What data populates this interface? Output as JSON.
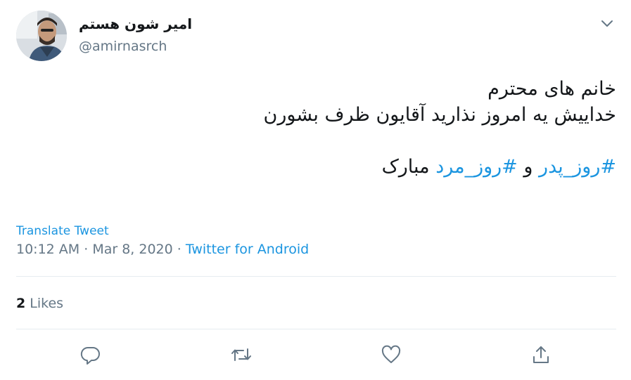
{
  "user": {
    "name": "امیر شون هستم",
    "handle": "@amirnasrch"
  },
  "tweet": {
    "line1": "خانم های محترم",
    "line2": "خداییش یه امروز نذارید آقایون ظرف بشورن",
    "hashtag1": "#روز_پدر",
    "conjunction": " و ",
    "hashtag2": "#روز_مرد",
    "suffix": " مبارک"
  },
  "translate_label": "Translate Tweet",
  "meta": {
    "time": "10:12 AM",
    "sep1": " · ",
    "date": "Mar 8, 2020",
    "sep2": " · ",
    "source": "Twitter for Android"
  },
  "stats": {
    "likes_count": "2",
    "likes_label": " Likes"
  },
  "colors": {
    "link": "#1b95e0",
    "secondary": "#657786",
    "divider": "#e6ecf0"
  },
  "icons": [
    "avatar",
    "chevron-down-icon",
    "reply-icon",
    "retweet-icon",
    "like-icon",
    "share-icon"
  ]
}
